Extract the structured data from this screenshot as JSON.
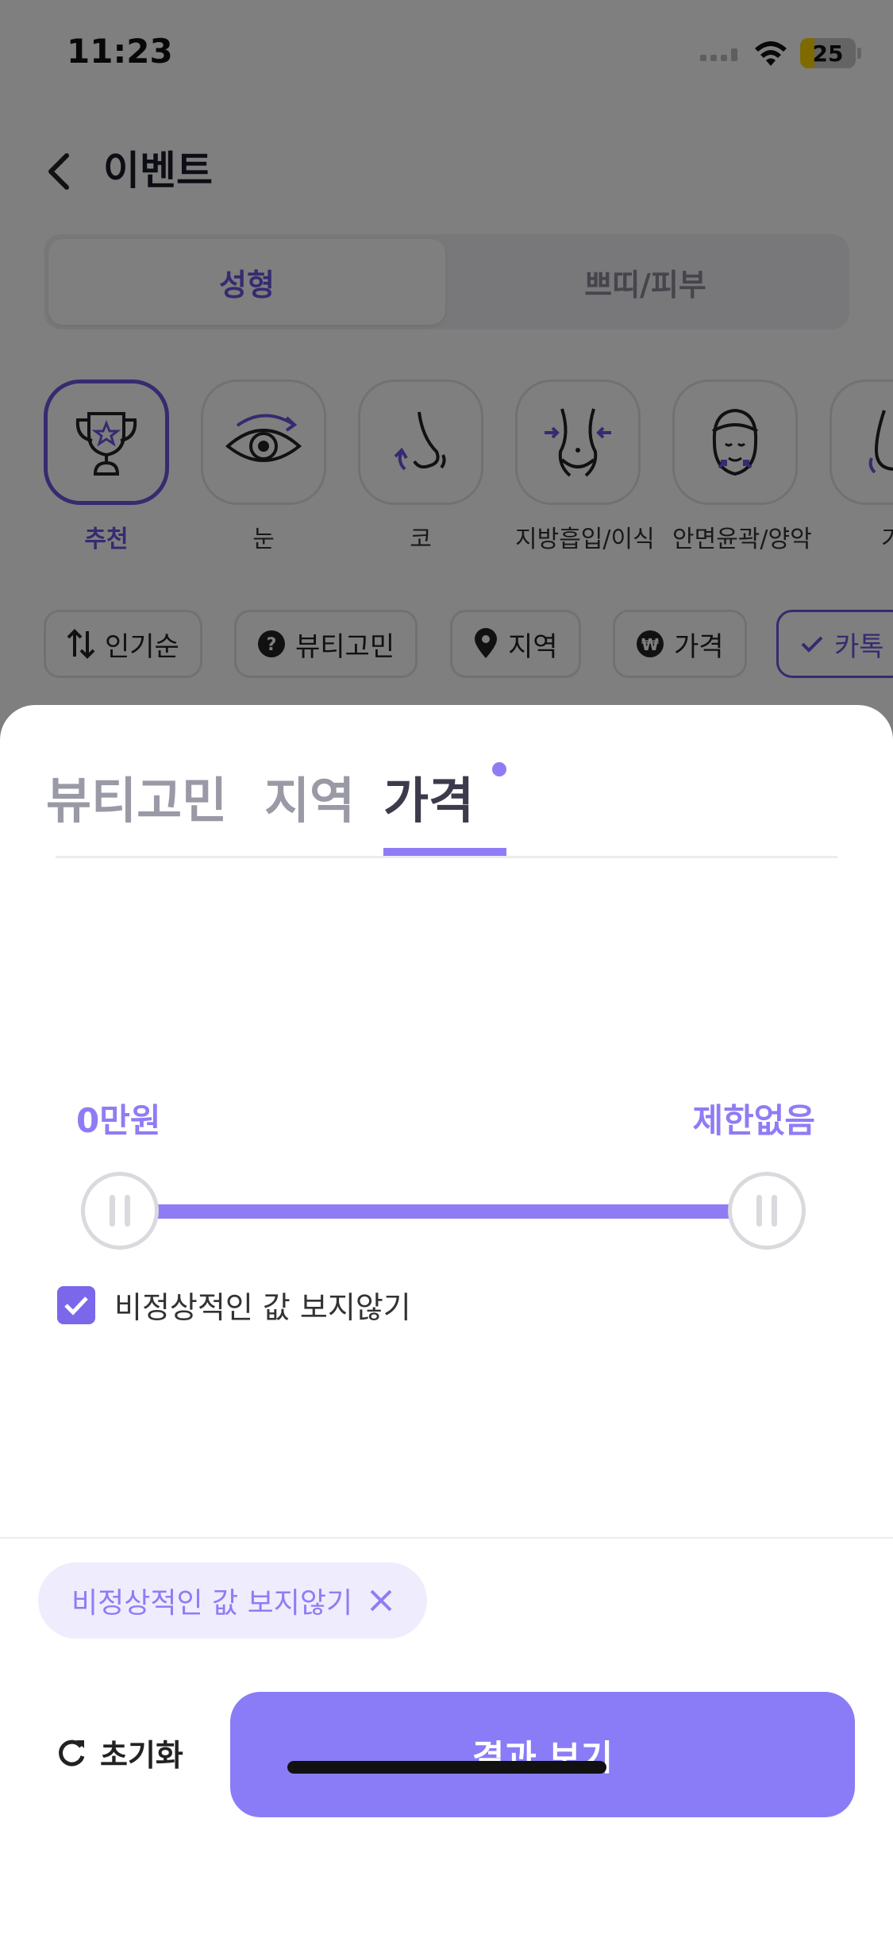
{
  "status_bar": {
    "time": "11:23",
    "battery": "25"
  },
  "header": {
    "title": "이벤트"
  },
  "segment": {
    "tabs": [
      "성형",
      "쁘띠/피부"
    ],
    "active_index": 0
  },
  "categories": [
    {
      "label": "추천",
      "icon": "trophy-star-icon",
      "active": true
    },
    {
      "label": "눈",
      "icon": "eye-icon",
      "active": false
    },
    {
      "label": "코",
      "icon": "nose-icon",
      "active": false
    },
    {
      "label": "지방흡입/이식",
      "icon": "body-waist-icon",
      "active": false
    },
    {
      "label": "안면윤곽/양악",
      "icon": "face-contour-icon",
      "active": false
    },
    {
      "label": "가",
      "icon": "chest-icon",
      "active": false
    }
  ],
  "filter_chips": [
    {
      "label": "인기순",
      "icon": "sort-arrows-icon"
    },
    {
      "label": "뷰티고민",
      "icon": "question-circle-icon"
    },
    {
      "label": "지역",
      "icon": "location-pin-icon"
    },
    {
      "label": "가격",
      "icon": "won-coin-icon"
    },
    {
      "label": "카톡",
      "icon": "check-icon",
      "selected": true
    }
  ],
  "sheet": {
    "tabs": [
      "뷰티고민",
      "지역",
      "가격"
    ],
    "active_tab": "가격",
    "price": {
      "min_label": "0만원",
      "max_label": "제한없음",
      "min_value": 0,
      "max_value": 1
    },
    "hide_abnormal": {
      "label": "비정상적인 값 보지않기",
      "checked": true
    },
    "applied_filter": "비정상적인 값 보지않기",
    "reset_label": "초기화",
    "result_label": "결과 보기"
  },
  "colors": {
    "accent": "#8f7cf5",
    "accent_dark": "#6a56e0",
    "overlay": "rgba(0,0,0,0.5)"
  }
}
